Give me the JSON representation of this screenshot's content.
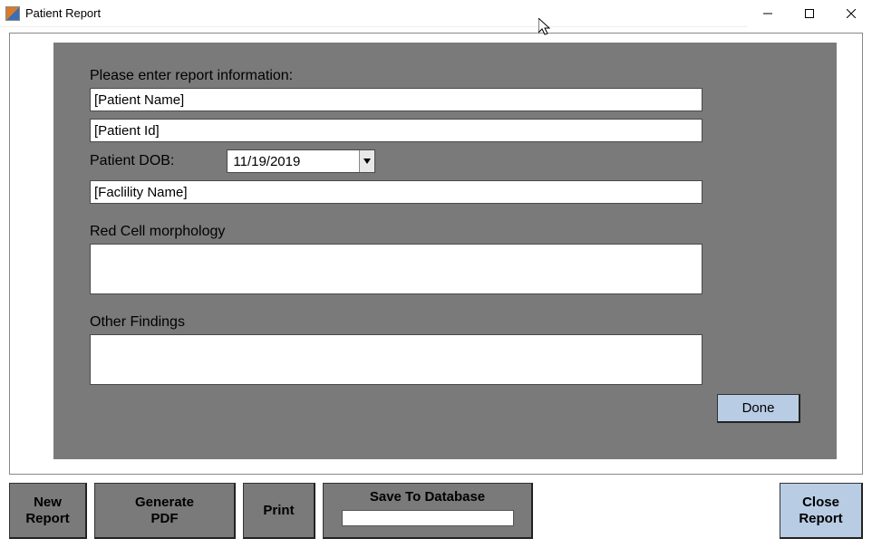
{
  "window": {
    "title": "Patient Report"
  },
  "form": {
    "headerLabel": "Please enter report information:",
    "patientNameValue": "[Patient Name]",
    "patientIdValue": "[Patient Id]",
    "dobLabel": "Patient DOB:",
    "dobValue": "11/19/2019",
    "facilityValue": "[Faclility Name]",
    "redCellLabel": "Red Cell morphology",
    "redCellValue": "",
    "otherFindingsLabel": "Other Findings",
    "otherFindingsValue": "",
    "doneLabel": "Done"
  },
  "toolbar": {
    "newReport": "New\nReport",
    "generatePdf": "Generate\nPDF",
    "print": "Print",
    "saveToDb": "Save To Database",
    "closeReport": "Close\nReport"
  }
}
